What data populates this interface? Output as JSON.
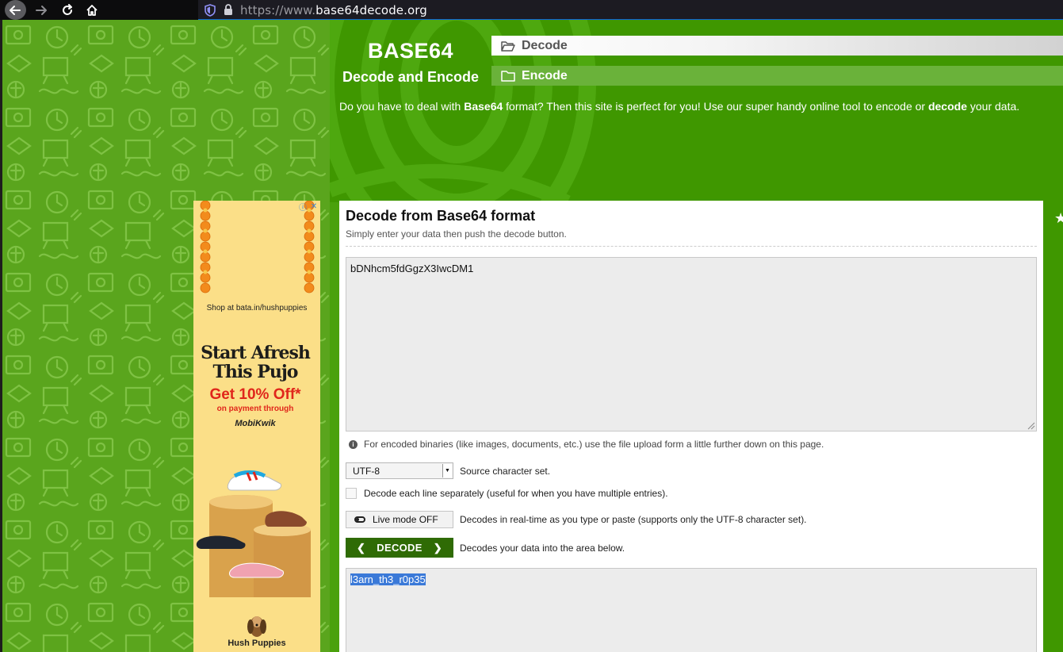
{
  "browser": {
    "url_prefix": "https://www.",
    "url_domain": "base64decode.org",
    "icons": [
      "back-icon",
      "forward-icon",
      "reload-icon",
      "home-icon",
      "shield-icon",
      "lock-icon"
    ]
  },
  "site": {
    "logo_title": "BASE64",
    "logo_subtitle": "Decode and Encode",
    "nav": [
      {
        "label": "Decode",
        "icon": "folder-open-icon"
      },
      {
        "label": "Encode",
        "icon": "folder-icon"
      }
    ],
    "intro": {
      "part1": "Do you have to deal with ",
      "bold1": "Base64",
      "part2": " format? Then this site is perfect for you! Use our super handy online tool to encode or ",
      "bold2": "decode",
      "part3": " your data."
    }
  },
  "ad": {
    "shop_text": "Shop at bata.in/hushpuppies",
    "headline_line1": "Start Afresh",
    "headline_line2": "This Pujo",
    "offer": "Get 10% Off*",
    "offer_sub": "on payment through",
    "payment_brand": "MobiKwik",
    "brand_logo_text": "Hush Puppies"
  },
  "tool": {
    "title": "Decode from Base64 format",
    "subtitle": "Simply enter your data then push the decode button.",
    "input_value": "bDNhcm5fdGgzX3IwcDM1",
    "binary_note": "For encoded binaries (like images, documents, etc.) use the file upload form a little further down on this page.",
    "charset": {
      "selected": "UTF-8",
      "label": "Source character set."
    },
    "each_line": {
      "checked": false,
      "label": "Decode each line separately (useful for when you have multiple entries)."
    },
    "live_mode": {
      "button_label": "Live mode OFF",
      "description": "Decodes in real-time as you type or paste (supports only the UTF-8 character set)."
    },
    "decode": {
      "button_label": "DECODE",
      "description": "Decodes your data into the area below."
    },
    "output_value": "l3arn_th3_r0p35"
  },
  "colors": {
    "header_green": "#3f9700",
    "pattern_green": "#5aa51d",
    "decode_button": "#2f6b05",
    "selection": "#3a79d8"
  }
}
